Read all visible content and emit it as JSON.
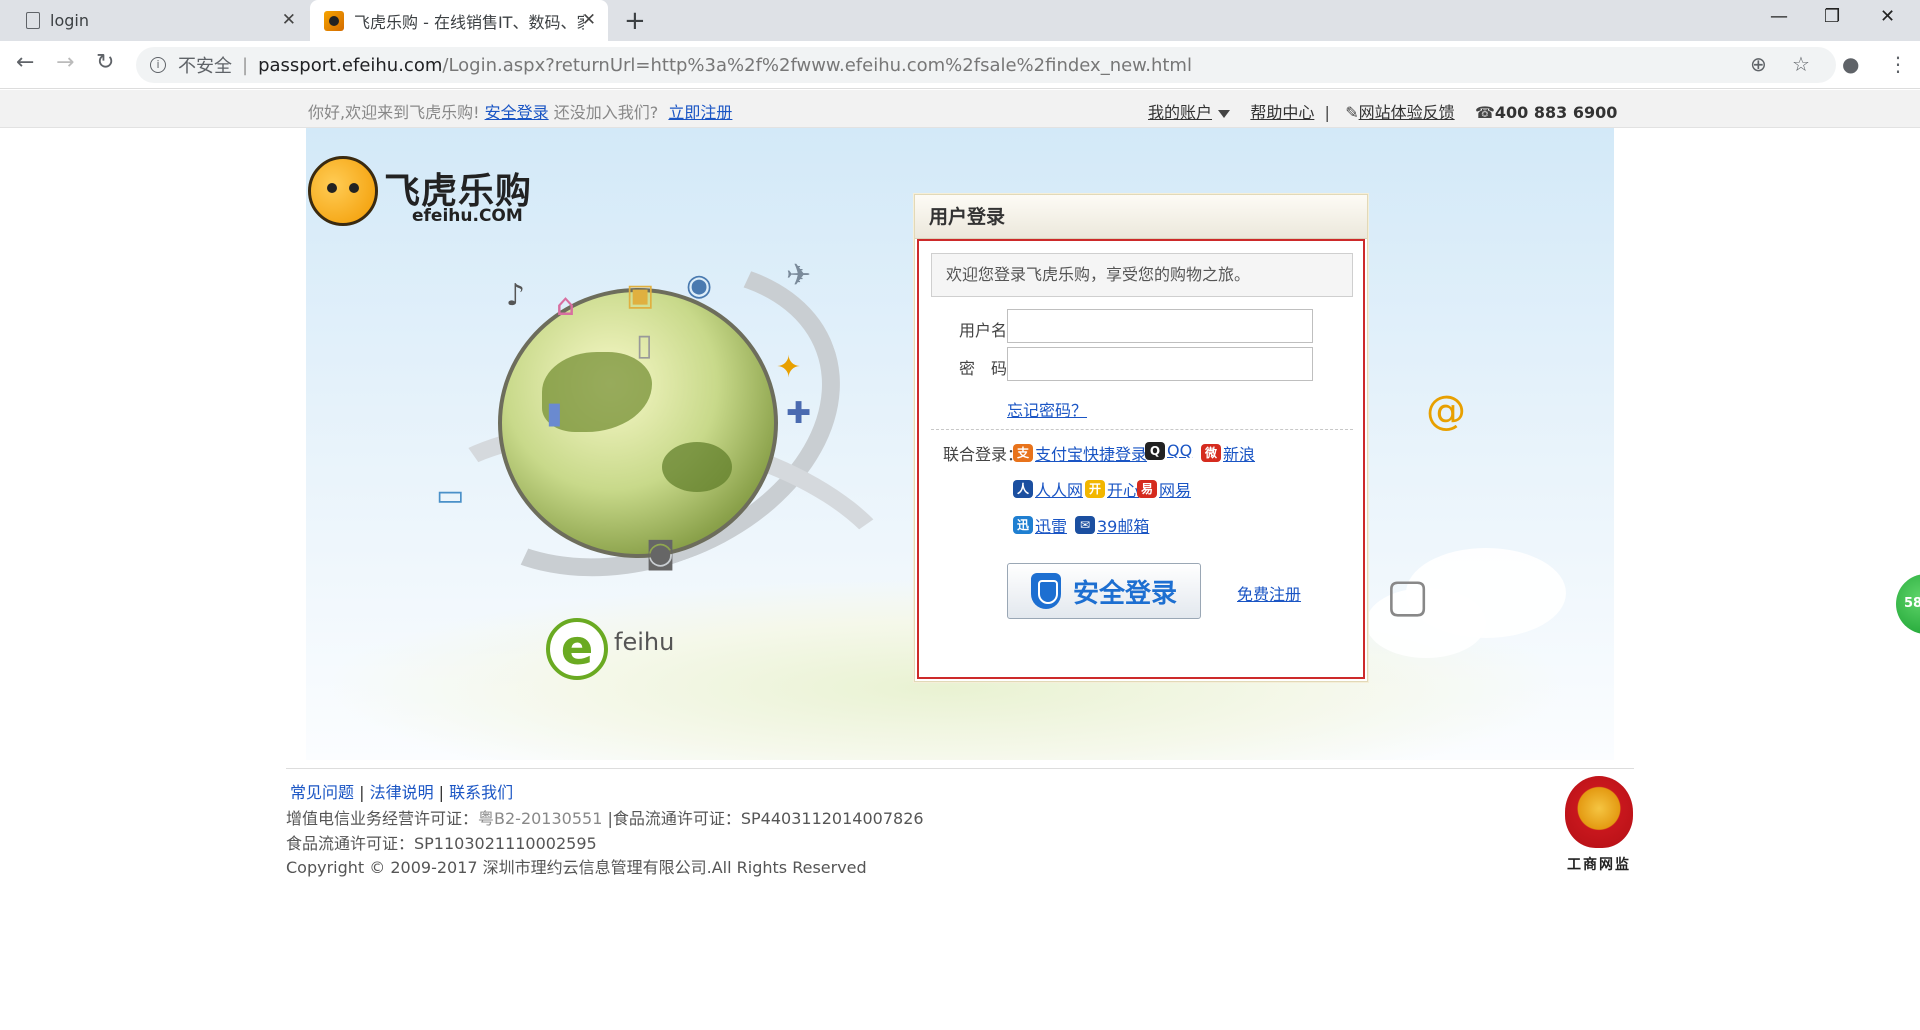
{
  "browser": {
    "tabs": [
      {
        "title": "login"
      },
      {
        "title": "飞虎乐购 - 在线销售IT、数码、家"
      }
    ],
    "address": {
      "security_label": "不安全",
      "host": "passport.efeihu.com",
      "path": "/Login.aspx?returnUrl=http%3a%2f%2fwww.efeihu.com%2fsale%2findex_new.html"
    }
  },
  "topbar": {
    "welcome": "你好,欢迎来到飞虎乐购!",
    "login_link": "安全登录",
    "join_text": "还没加入我们?",
    "register_link": "立即注册",
    "my_account": "我的账户",
    "help": "帮助中心",
    "divider": "|",
    "feedback": "网站体验反馈",
    "phone": "400  883  6900"
  },
  "logo": {
    "cn": "飞虎乐购",
    "en": "efeihu.COM"
  },
  "hero": {
    "badge_letter": "e",
    "badge_text": "feihu"
  },
  "login": {
    "title": "用户登录",
    "welcome": "欢迎您登录飞虎乐购，享受您的购物之旅。",
    "username_label": "用户名：",
    "password_label": "密　码：",
    "username_value": "",
    "password_value": "",
    "forgot": "忘记密码？",
    "union_label": "联合登录：",
    "sso": [
      {
        "name": "支付宝快捷登录",
        "color": "#e8731b"
      },
      {
        "name": "QQ",
        "color": "#222222"
      },
      {
        "name": "新浪",
        "color": "#d52b1e"
      },
      {
        "name": "人人网",
        "color": "#1b4fa0"
      },
      {
        "name": "开心",
        "color": "#f2b600"
      },
      {
        "name": "网易",
        "color": "#d52b1e"
      },
      {
        "name": "迅雷",
        "color": "#1f7fd1"
      },
      {
        "name": "39邮箱",
        "color": "#1b4fa0"
      }
    ],
    "submit": "安全登录",
    "free_register": "免费注册"
  },
  "side_bubble": "58",
  "footer": {
    "links": [
      "常见问题",
      "法律说明",
      "联系我们"
    ],
    "license1_label": "增值电信业务经营许可证：",
    "license1_value": "粤B2-20130551",
    "license2": " |食品流通许可证：SP4403112014007826",
    "license3": "食品流通许可证：SP1103021110002595",
    "copyright": "Copyright © 2009-2017 深圳市理约云信息管理有限公司.All Rights Reserved",
    "badge_label": "工商网监"
  }
}
